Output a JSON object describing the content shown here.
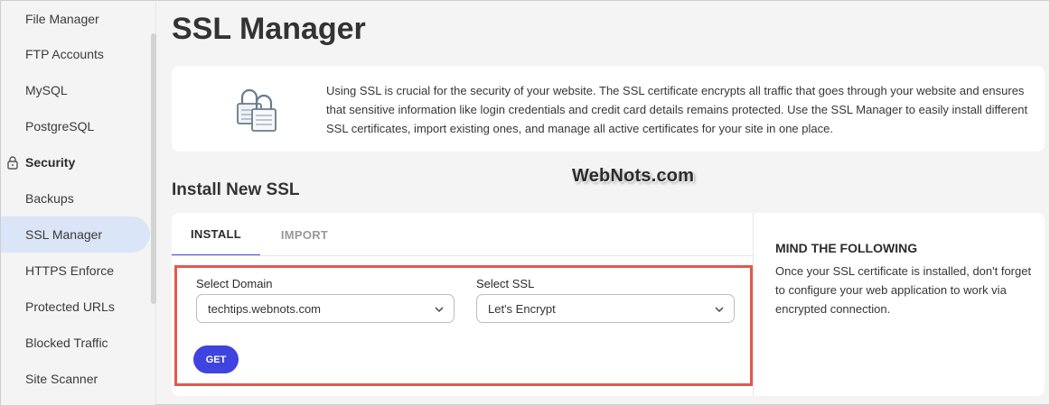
{
  "sidebar": {
    "items": [
      {
        "label": "File Manager"
      },
      {
        "label": "FTP Accounts"
      },
      {
        "label": "MySQL"
      },
      {
        "label": "PostgreSQL"
      },
      {
        "label": "Security"
      },
      {
        "label": "Backups"
      },
      {
        "label": "SSL Manager"
      },
      {
        "label": "HTTPS Enforce"
      },
      {
        "label": "Protected URLs"
      },
      {
        "label": "Blocked Traffic"
      },
      {
        "label": "Site Scanner"
      }
    ],
    "active": "SSL Manager"
  },
  "page": {
    "title": "SSL Manager",
    "info": "Using SSL is crucial for the security of your website. The SSL certificate encrypts all traffic that goes through your website and ensures that sensitive information like login credentials and credit card details remains protected. Use the SSL Manager to easily install different SSL certificates, import existing ones, and manage all active certificates for your site in one place.",
    "watermark": "WebNots.com"
  },
  "install": {
    "section_title": "Install New SSL",
    "tabs": [
      {
        "label": "INSTALL",
        "active": true
      },
      {
        "label": "IMPORT",
        "active": false
      }
    ],
    "domain_label": "Select Domain",
    "domain_value": "techtips.webnots.com",
    "ssl_label": "Select SSL",
    "ssl_value": "Let's Encrypt",
    "get_label": "GET"
  },
  "notice": {
    "title": "MIND THE FOLLOWING",
    "text": "Once your SSL certificate is installed, don't forget to configure your web application to work via encrypted connection."
  },
  "colors": {
    "accent": "#3f43e0",
    "active_bg": "#dae5f7",
    "highlight": "#e5574d"
  }
}
